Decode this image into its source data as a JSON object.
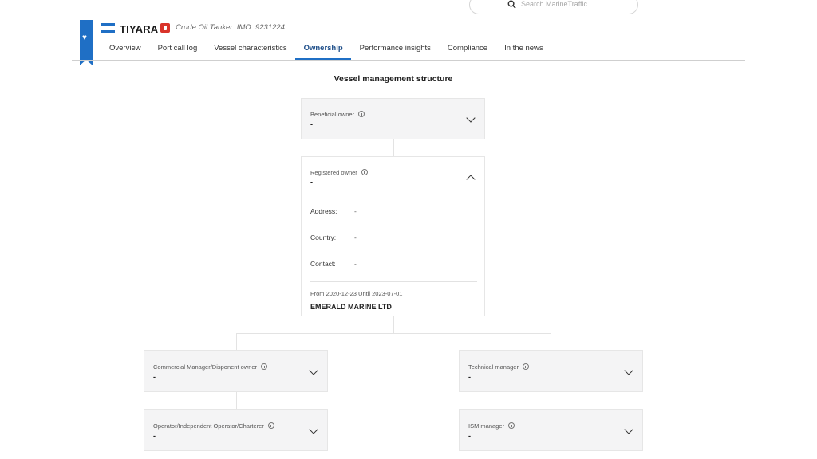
{
  "search": {
    "placeholder": "Search MarineTraffic"
  },
  "vessel": {
    "name": "TIYARA",
    "type": "Crude Oil Tanker",
    "imo": "IMO: 9231224",
    "flag_colors": [
      "#1f6fc5",
      "#ffffff",
      "#1f6fc5"
    ]
  },
  "tabs": [
    {
      "label": "Overview",
      "active": false
    },
    {
      "label": "Port call log",
      "active": false
    },
    {
      "label": "Vessel characteristics",
      "active": false
    },
    {
      "label": "Ownership",
      "active": true
    },
    {
      "label": "Performance insights",
      "active": false
    },
    {
      "label": "Compliance",
      "active": false
    },
    {
      "label": "In the news",
      "active": false
    }
  ],
  "section_title": "Vessel management structure",
  "beneficial_owner": {
    "label": "Beneficial owner",
    "value": "-"
  },
  "registered_owner": {
    "label": "Registered owner",
    "value": "-",
    "address_label": "Address:",
    "address_value": "-",
    "country_label": "Country:",
    "country_value": "-",
    "contact_label": "Contact:",
    "contact_value": "-",
    "period": "From 2020-12-23 Until 2023-07-01",
    "company": "EMERALD MARINE LTD"
  },
  "commercial_manager": {
    "label": "Commercial Manager/Disponent owner",
    "value": "-"
  },
  "technical_manager": {
    "label": "Technical manager",
    "value": "-"
  },
  "operator": {
    "label": "Operator/Independent Operator/Charterer",
    "value": "-"
  },
  "ism_manager": {
    "label": "ISM manager",
    "value": "-"
  },
  "colors": {
    "accent": "#1f6fc5",
    "active_tab": "#1f4f8a",
    "card_bg": "#f4f4f5"
  }
}
